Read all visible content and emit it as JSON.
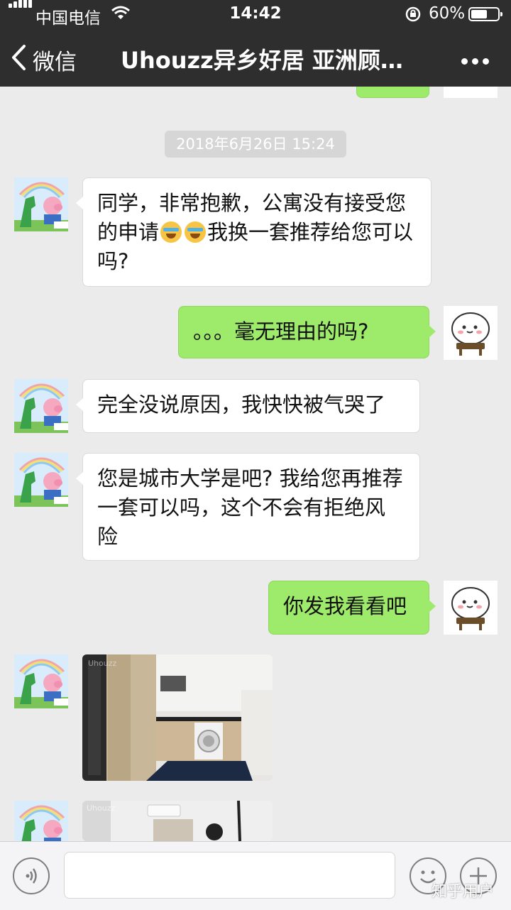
{
  "status_bar": {
    "carrier": "中国电信",
    "time": "14:42",
    "battery_percent": "60%",
    "battery_level": 0.6,
    "icons": [
      "signal-icon",
      "wifi-icon",
      "rotation-lock-icon",
      "battery-icon"
    ]
  },
  "nav": {
    "back_label": "微信",
    "title": "Uhouzz异乡好居 亚洲顾…",
    "icons": [
      "chevron-left-icon",
      "more-icon"
    ]
  },
  "chat": {
    "timestamp": "2018年6月26日 15:24",
    "messages": [
      {
        "side": "left",
        "text_before": "同学，非常抱歉，公寓没有接受您的申请",
        "emojis": [
          "crying-laughing-emoji",
          "crying-laughing-emoji"
        ],
        "text_after": "我换一套推荐给您可以吗?"
      },
      {
        "side": "right",
        "text": "。。。毫无理由的吗?"
      },
      {
        "side": "left",
        "text": "完全没说原因，我快快被气哭了"
      },
      {
        "side": "left",
        "text": "您是城市大学是吧? 我给您再推荐一套可以吗，这个不会有拒绝风险"
      },
      {
        "side": "right",
        "text": "你发我看看吧"
      },
      {
        "side": "left",
        "type": "image",
        "watermark": "Uhouzz"
      },
      {
        "side": "left",
        "type": "image",
        "watermark": "Uhouzz"
      }
    ]
  },
  "input_bar": {
    "icons": [
      "voice-icon",
      "emoji-icon",
      "plus-icon"
    ]
  },
  "watermark": "知乎用户",
  "colors": {
    "header_bg": "#2e2e2e",
    "chat_bg": "#ebebeb",
    "bubble_self": "#9eea6a",
    "bubble_other": "#ffffff"
  }
}
